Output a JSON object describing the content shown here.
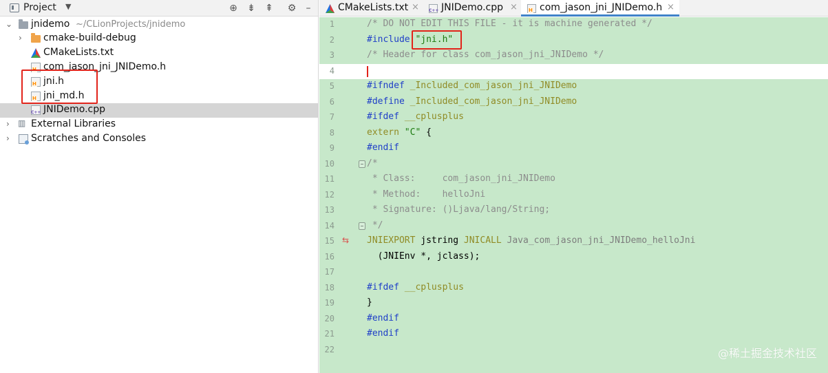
{
  "project_panel": {
    "title": "Project",
    "caret": "▼",
    "actions": [
      {
        "name": "locate-file-button",
        "glyph": "⊕"
      },
      {
        "name": "expand-all-button",
        "glyph": "⇟"
      },
      {
        "name": "collapse-all-button",
        "glyph": "⇞"
      },
      {
        "name": "settings-button",
        "glyph": "⚙"
      },
      {
        "name": "hide-panel-button",
        "glyph": "–"
      }
    ],
    "tree": {
      "root": {
        "label": "jnidemo",
        "path": "~/CLionProjects/jnidemo",
        "icon": "folder-icon"
      },
      "items": [
        {
          "label": "cmake-build-debug",
          "icon": "folder-icon"
        },
        {
          "label": "CMakeLists.txt",
          "icon": "cmake-icon"
        },
        {
          "label": "com_jason_jni_JNIDemo.h",
          "icon": "header-file-icon"
        },
        {
          "label": "jni.h",
          "icon": "header-file-icon"
        },
        {
          "label": "jni_md.h",
          "icon": "header-file-icon"
        },
        {
          "label": "JNIDemo.cpp",
          "icon": "cpp-file-icon",
          "selected": true
        },
        {
          "label": "External Libraries",
          "icon": "libraries-icon"
        },
        {
          "label": "Scratches and Consoles",
          "icon": "scratches-icon"
        }
      ]
    }
  },
  "editor_tabs": [
    {
      "label": "CMakeLists.txt",
      "icon": "cmake-icon",
      "close": "×",
      "active": false
    },
    {
      "label": "JNIDemo.cpp",
      "icon": "cpp-file-icon",
      "close": "×",
      "active": false
    },
    {
      "label": "com_jason_jni_JNIDemo.h",
      "icon": "header-file-icon",
      "close": "×",
      "active": true
    }
  ],
  "editor": {
    "current_line": 4,
    "lines": [
      {
        "n": "1",
        "text": "/* DO NOT EDIT THIS FILE - it is machine generated */"
      },
      {
        "n": "2",
        "directive": "#include ",
        "string": "\"jni.h\""
      },
      {
        "n": "3",
        "text": "/* Header for class com_jason_jni_JNIDemo */"
      },
      {
        "n": "4",
        "text": ""
      },
      {
        "n": "5",
        "directive": "#ifndef ",
        "macro": "_Included_com_jason_jni_JNIDemo"
      },
      {
        "n": "6",
        "directive": "#define ",
        "macro": "_Included_com_jason_jni_JNIDemo"
      },
      {
        "n": "7",
        "directive": "#ifdef ",
        "macro": "__cplusplus"
      },
      {
        "n": "8",
        "keyword": "extern ",
        "string": "\"C\"",
        "plain": " {"
      },
      {
        "n": "9",
        "directive": "#endif"
      },
      {
        "n": "10",
        "text": "/*"
      },
      {
        "n": "11",
        "text": " * Class:     com_jason_jni_JNIDemo"
      },
      {
        "n": "12",
        "text": " * Method:    helloJni"
      },
      {
        "n": "13",
        "text": " * Signature: ()Ljava/lang/String;"
      },
      {
        "n": "14",
        "text": " */"
      },
      {
        "n": "15",
        "macro": "JNIEXPORT",
        "plain": " jstring ",
        "macro2": "JNICALL",
        "rest": " Java_com_jason_jni_JNIDemo_helloJni"
      },
      {
        "n": "16",
        "plain": "  (JNIEnv *, jclass);"
      },
      {
        "n": "17",
        "text": ""
      },
      {
        "n": "18",
        "directive": "#ifdef ",
        "macro": "__cplusplus"
      },
      {
        "n": "19",
        "plain": "}"
      },
      {
        "n": "20",
        "directive": "#endif"
      },
      {
        "n": "21",
        "directive": "#endif"
      },
      {
        "n": "22",
        "text": ""
      }
    ]
  },
  "watermark": "@稀土掘金技术社区",
  "colors": {
    "editor_background": "#c7e8ca",
    "highlight_box": "#e2231a",
    "active_tab_underline": "#4083c9",
    "directive": "#1f3fc8",
    "string": "#1b7a0e",
    "macro": "#908b25",
    "comment": "#8c8c8c"
  }
}
